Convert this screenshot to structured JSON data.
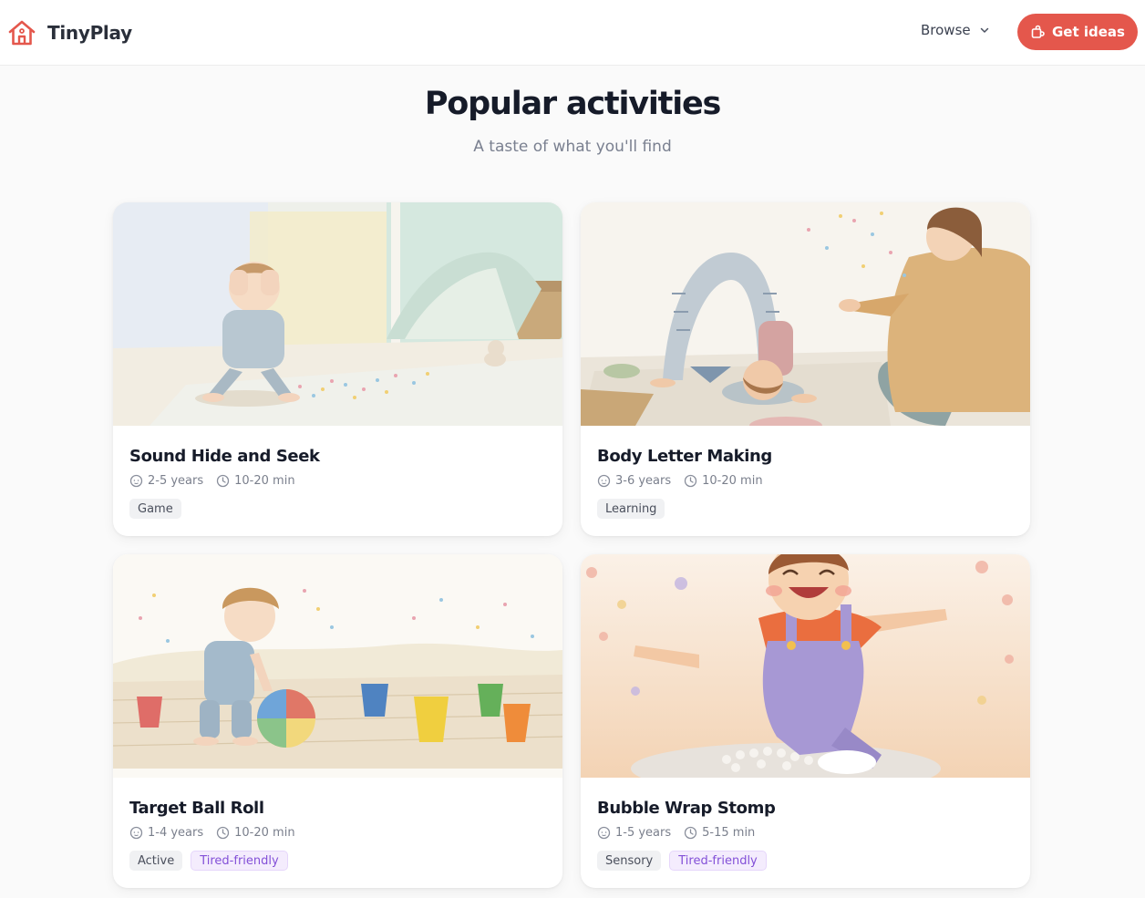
{
  "header": {
    "brand_name": "TinyPlay",
    "browse_label": "Browse",
    "cta_label": "Get ideas"
  },
  "hero": {
    "title": "Popular activities",
    "subtitle": "A taste of what you'll find"
  },
  "cards": [
    {
      "title": "Sound Hide and Seek",
      "age": "2-5 years",
      "duration": "10-20 min",
      "tags": [
        "Game"
      ]
    },
    {
      "title": "Body Letter Making",
      "age": "3-6 years",
      "duration": "10-20 min",
      "tags": [
        "Learning"
      ]
    },
    {
      "title": "Target Ball Roll",
      "age": "1-4 years",
      "duration": "10-20 min",
      "tags": [
        "Active",
        "Tired-friendly"
      ]
    },
    {
      "title": "Bubble Wrap Stomp",
      "age": "1-5 years",
      "duration": "5-15 min",
      "tags": [
        "Sensory",
        "Tired-friendly"
      ]
    }
  ],
  "colors": {
    "accent": "#e4574c",
    "tag_purple_text": "#8350d8",
    "tag_purple_bg": "#f4ecfd",
    "tag_gray_bg": "#f0f1f3"
  },
  "icons": {
    "logo": "house-icon",
    "browse": "chevron-down-icon",
    "cta": "puzzle-icon",
    "age": "child-face-icon",
    "duration": "clock-icon"
  }
}
